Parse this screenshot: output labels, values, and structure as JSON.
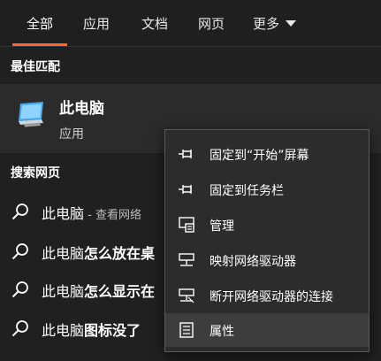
{
  "tabs": [
    {
      "label": "全部"
    },
    {
      "label": "应用"
    },
    {
      "label": "文档"
    },
    {
      "label": "网页"
    },
    {
      "label": "更多"
    }
  ],
  "best_match": {
    "section_label": "最佳匹配",
    "title": "此电脑",
    "subtitle": "应用",
    "icon": "computer-icon"
  },
  "web": {
    "section_label": "搜索网页",
    "results": [
      {
        "prefix": "此电脑",
        "bold": "",
        "hint": " - 查看网络"
      },
      {
        "prefix": "此电脑",
        "bold": "怎么放在桌",
        "hint": ""
      },
      {
        "prefix": "此电脑",
        "bold": "怎么显示在",
        "hint": ""
      },
      {
        "prefix": "此电脑",
        "bold": "图标没了",
        "hint": ""
      }
    ]
  },
  "context_menu": {
    "items": [
      {
        "label": "固定到“开始”屏幕",
        "icon": "pin-icon"
      },
      {
        "label": "固定到任务栏",
        "icon": "pin-icon"
      },
      {
        "label": "管理",
        "icon": "manage-icon"
      },
      {
        "label": "映射网络驱动器",
        "icon": "network-drive-icon"
      },
      {
        "label": "断开网络驱动器的连接",
        "icon": "disconnect-drive-icon"
      },
      {
        "label": "属性",
        "icon": "properties-icon"
      }
    ]
  },
  "colors": {
    "accent": "#ff6a2b",
    "background": "#202020",
    "menu_background": "#2c2c2c",
    "highlight": "#3d3d3d"
  }
}
